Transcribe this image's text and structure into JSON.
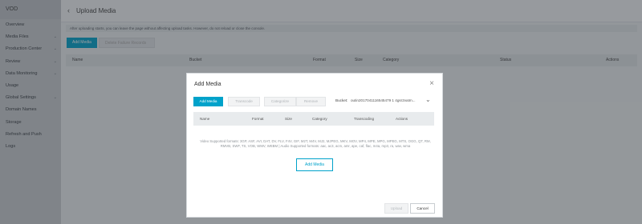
{
  "sidebar": {
    "title": "VOD",
    "items": [
      {
        "label": "Overview",
        "expandable": false
      },
      {
        "label": "Media Files",
        "expandable": true
      },
      {
        "label": "Production Center",
        "expandable": true
      },
      {
        "label": "Review",
        "expandable": true
      },
      {
        "label": "Data Monitoring",
        "expandable": true
      },
      {
        "label": "Usage",
        "expandable": false
      },
      {
        "label": "Global Settings",
        "expandable": true
      },
      {
        "label": "Domain Names",
        "expandable": false
      },
      {
        "label": "Storage",
        "expandable": false
      },
      {
        "label": "Refresh and Push",
        "expandable": false
      },
      {
        "label": "Logs",
        "expandable": false
      }
    ]
  },
  "header": {
    "back_icon": "chevron-left-icon",
    "title": "Upload Media"
  },
  "notice": "After uploading starts, you can leave the page without affecting upload tasks. However, do not reload or close the console.",
  "toolbar": {
    "add_label": "Add Media",
    "delete_label": "Delete Failure Records"
  },
  "table": {
    "columns": [
      "Name",
      "Bucket",
      "Format",
      "Size",
      "Category",
      "Status",
      "Actions"
    ]
  },
  "modal": {
    "title": "Add Media",
    "buttons": {
      "add": "Add Media",
      "transcode": "Transcode",
      "categorize": "Categorize",
      "remove": "Remove"
    },
    "bucket_label": "Bucket:",
    "bucket_value": "outin2017041116545479 1 4gsr2vatm...",
    "columns": [
      "Name",
      "Format",
      "Size",
      "Category",
      "Transcoding",
      "Actions"
    ],
    "formats_text": "Video Supported formats: 3GP, ASF, AVI, DAT, DV, FLV, F4V, GIF, M2T, M4V, MJ2, MJPEG, MKV, MOV, MP4, MPE, MPG, MPEG, MTS, OGG, QT, RM, RMVB, SWF, TS, VOB, WMV, WEBM | Audio Supported formats: aac, ac3, acm, amr, ape, caf, flac, m4a, mp3, ra, wav, wma",
    "add_outline_label": "Add Media",
    "upload_label": "Upload",
    "cancel_label": "Cancel"
  },
  "colors": {
    "accent": "#00a2ca",
    "sidebar_bg": "#c8ccd0",
    "overlay": "rgba(40,45,50,0.45)"
  }
}
